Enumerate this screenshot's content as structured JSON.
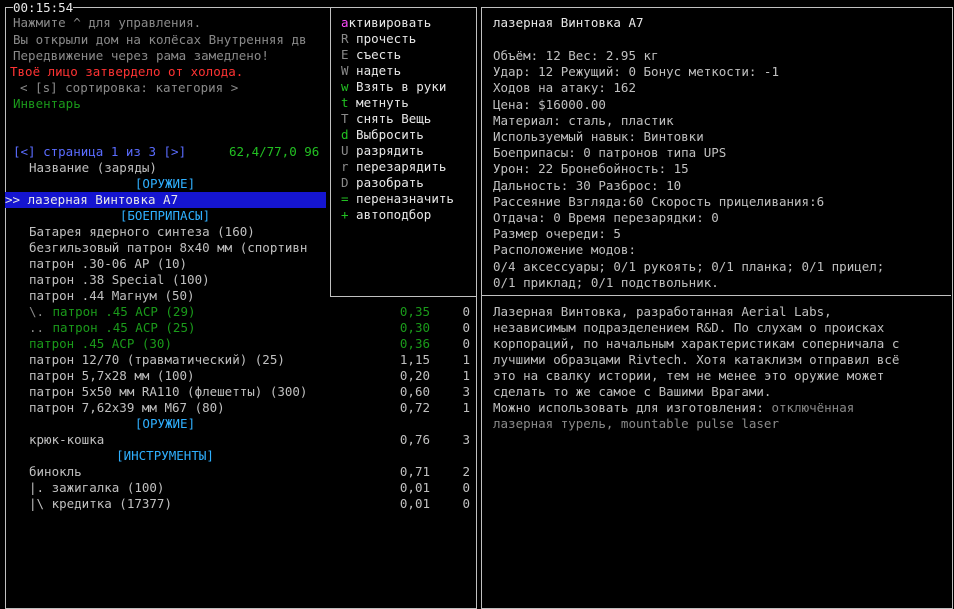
{
  "clock": "00:15:54",
  "log": [
    "Нажмите ^ для управления.",
    "Вы открыли дом на колёсах Внутренняя дв",
    "Передвижение через рама замедлено!",
    "Твоё лицо затвердело от холода."
  ],
  "sort_bar": "< [s] сортировка: категория >",
  "inventory_label": "Инвентарь",
  "pager": {
    "text": "[<] страница 1 из 3 [>]",
    "weight_volume": "62,4/77,0 96"
  },
  "column_header": "Название (заряды)",
  "items": [
    {
      "kind": "header",
      "text": "[ОРУЖИЕ]"
    },
    {
      "kind": "selected",
      "text": ">> лазерная Винтовка A7"
    },
    {
      "kind": "header",
      "text": "[БОЕПРИПАСЫ]"
    },
    {
      "kind": "item",
      "text": "Батарея ядерного синтеза (160)",
      "w": "",
      "v": ""
    },
    {
      "kind": "item",
      "text": "безгильзовый патрон 8x40 мм (спортивн",
      "w": "",
      "v": ""
    },
    {
      "kind": "item",
      "text": "патрон .30-06 AP (10)",
      "w": "",
      "v": ""
    },
    {
      "kind": "item",
      "text": "патрон .38 Special (100)",
      "w": "",
      "v": ""
    },
    {
      "kind": "item",
      "text": "патрон .44 Магнум (50)",
      "w": "",
      "v": ""
    },
    {
      "kind": "sub",
      "prefix": "\\.",
      "text": " патрон .45 ACP (29)",
      "w": "0,35",
      "v": "0"
    },
    {
      "kind": "sub",
      "prefix": "..",
      "text": " патрон .45 ACP (25)",
      "w": "0,30",
      "v": "0"
    },
    {
      "kind": "sub",
      "prefix": "",
      "text": "патрон .45 ACP (30)",
      "w": "0,36",
      "v": "0"
    },
    {
      "kind": "item",
      "text": "патрон 12/70 (травматический) (25)",
      "w": "1,15",
      "v": "1"
    },
    {
      "kind": "item",
      "text": "патрон 5,7x28 мм (100)",
      "w": "0,20",
      "v": "1"
    },
    {
      "kind": "item",
      "text": "патрон 5x50 мм RA110 (флешетты) (300)",
      "w": "0,60",
      "v": "3"
    },
    {
      "kind": "item",
      "text": "патрон 7,62x39 мм M67 (80)",
      "w": "0,72",
      "v": "1"
    },
    {
      "kind": "header",
      "text": "[ОРУЖИЕ]"
    },
    {
      "kind": "item",
      "text": "крюк-кошка",
      "w": "0,76",
      "v": "3"
    },
    {
      "kind": "header",
      "text": "[ИНСТРУМЕНТЫ]"
    },
    {
      "kind": "item",
      "text": "бинокль",
      "w": "0,71",
      "v": "2"
    },
    {
      "kind": "item",
      "text": "|. зажигалка (100)",
      "w": "0,01",
      "v": "0"
    },
    {
      "kind": "item",
      "text": "|\\ кредитка (17377)",
      "w": "0,01",
      "v": "0"
    }
  ],
  "menu": [
    {
      "key": "а",
      "label": "ктивировать"
    },
    {
      "key": "R",
      "label": " прочесть"
    },
    {
      "key": "E",
      "label": " съесть"
    },
    {
      "key": "W",
      "label": " надеть"
    },
    {
      "key": "w",
      "label": " Взять в руки"
    },
    {
      "key": "t",
      "label": " метнуть"
    },
    {
      "key": "T",
      "label": " снять Вещь"
    },
    {
      "key": "d",
      "label": " Выбросить"
    },
    {
      "key": "U",
      "label": " разрядить"
    },
    {
      "key": "r",
      "label": " перезарядить"
    },
    {
      "key": "D",
      "label": " разобрать"
    },
    {
      "key": "=",
      "label": " переназначить"
    },
    {
      "key": "+",
      "label": " автоподбор"
    }
  ],
  "info": {
    "title": "лазерная Винтовка A7",
    "stats": [
      "Объём: 12 Вес: 2.95 кг",
      "Удар: 12 Режущий: 0 Бонус меткости: -1",
      "Ходов на атаку: 162",
      "Цена: $16000.00",
      "Материал: сталь, пластик",
      "Используемый навык: Винтовки",
      "Боеприпасы: 0 патронов типа UPS",
      "Урон: 22 Бронебойность: 15",
      "Дальность: 30 Разброс: 10",
      "Рассеяние Взгляда:60 Скорость прицеливания:6",
      "Отдача: 0 Время перезарядки: 0",
      "Размер очереди: 5",
      "Расположение модов:",
      "0/4 аксессуары; 0/1 рукоять; 0/1 планка; 0/1 прицел;",
      "0/1 приклад; 0/1 подствольник."
    ],
    "description": [
      "Лазерная Винтовка, разработанная Aerial Labs,",
      "независимым подразделением R&D. По слухам о происках",
      "корпораций, по начальным характеристикам соперничала с",
      "лучшими образцами Rivtech. Хотя катаклизм отправил всё",
      "это на свалку истории, тем не менее это оружие может",
      "сделать то же самое с Вашими Врагами."
    ],
    "craft_label": "Можно использовать для изготовления:",
    "craft_first": "отключённая",
    "craft_second": "лазерная турель, mountable pulse laser"
  }
}
